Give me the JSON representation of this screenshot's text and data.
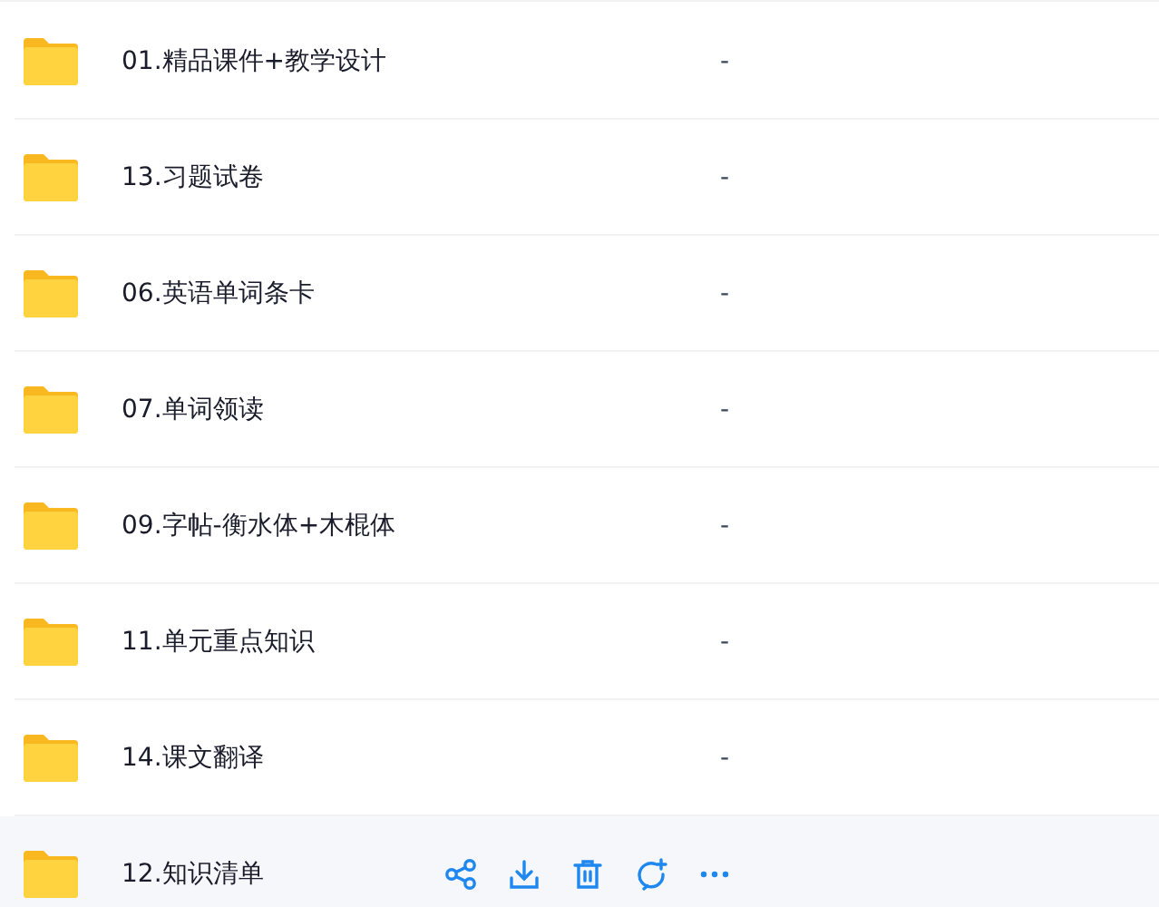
{
  "files": [
    {
      "name": "01.精品课件+教学设计",
      "size": "-",
      "hovered": false
    },
    {
      "name": "13.习题试卷",
      "size": "-",
      "hovered": false
    },
    {
      "name": "06.英语单词条卡",
      "size": "-",
      "hovered": false
    },
    {
      "name": "07.单词领读",
      "size": "-",
      "hovered": false
    },
    {
      "name": "09.字帖-衡水体+木棍体",
      "size": "-",
      "hovered": false
    },
    {
      "name": "11.单元重点知识",
      "size": "-",
      "hovered": false
    },
    {
      "name": "14.课文翻译",
      "size": "-",
      "hovered": false
    },
    {
      "name": "12.知识清单",
      "hovered": true
    }
  ]
}
